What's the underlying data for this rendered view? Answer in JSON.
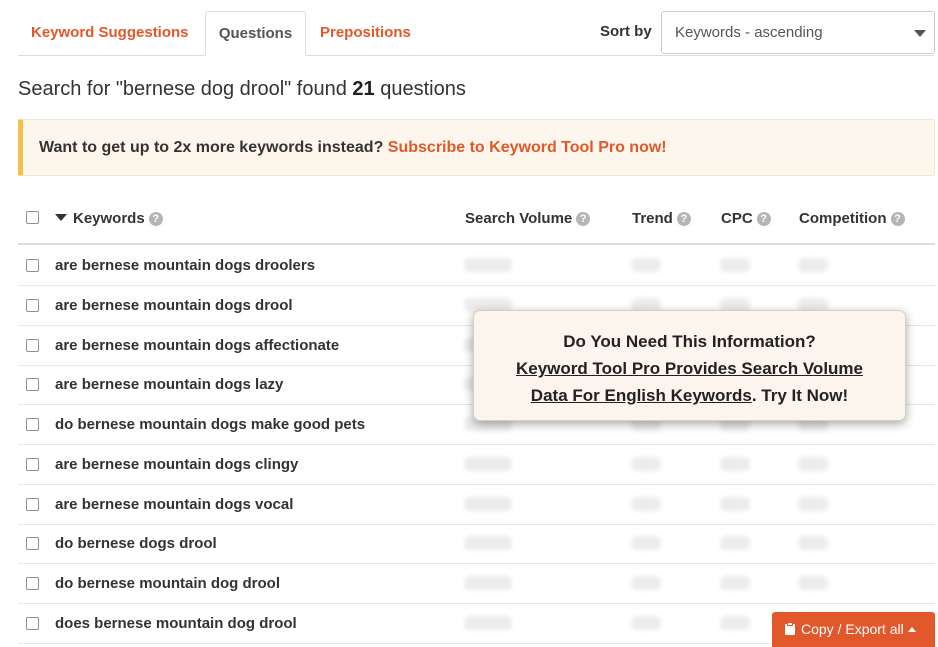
{
  "tabs": [
    {
      "label": "Keyword Suggestions",
      "active": false
    },
    {
      "label": "Questions",
      "active": true
    },
    {
      "label": "Prepositions",
      "active": false
    }
  ],
  "sort": {
    "label": "Sort by",
    "value": "Keywords - ascending"
  },
  "results": {
    "prefix": "Search for \"bernese dog drool\" found",
    "count": "21",
    "suffix": "questions"
  },
  "promo": {
    "text": "Want to get up to 2x more keywords instead?",
    "link": "Subscribe to Keyword Tool Pro now!"
  },
  "table": {
    "columns": [
      "Keywords",
      "Search Volume",
      "Trend",
      "CPC",
      "Competition"
    ],
    "rows": [
      "are bernese mountain dogs droolers",
      "are bernese mountain dogs drool",
      "are bernese mountain dogs affectionate",
      "are bernese mountain dogs lazy",
      "do bernese mountain dogs make good pets",
      "are bernese mountain dogs clingy",
      "are bernese mountain dogs vocal",
      "do bernese dogs drool",
      "do bernese mountain dog drool",
      "does bernese mountain dog drool"
    ]
  },
  "popup": {
    "line1": "Do You Need This Information?",
    "line2": "Keyword Tool Pro Provides Search Volume",
    "line3_link": "Data For English Keywords",
    "line3_tail": ". Try It Now!"
  },
  "export": {
    "label": "Copy / Export all"
  },
  "icons": {
    "help": "question-circle-icon",
    "sort": "caret-down-icon",
    "export": "clipboard-icon"
  },
  "colors": {
    "accent": "#e2582a",
    "promo_bg": "#fdf6ec",
    "promo_border": "#f0c24b",
    "popup_bg": "#fbf5ee"
  }
}
